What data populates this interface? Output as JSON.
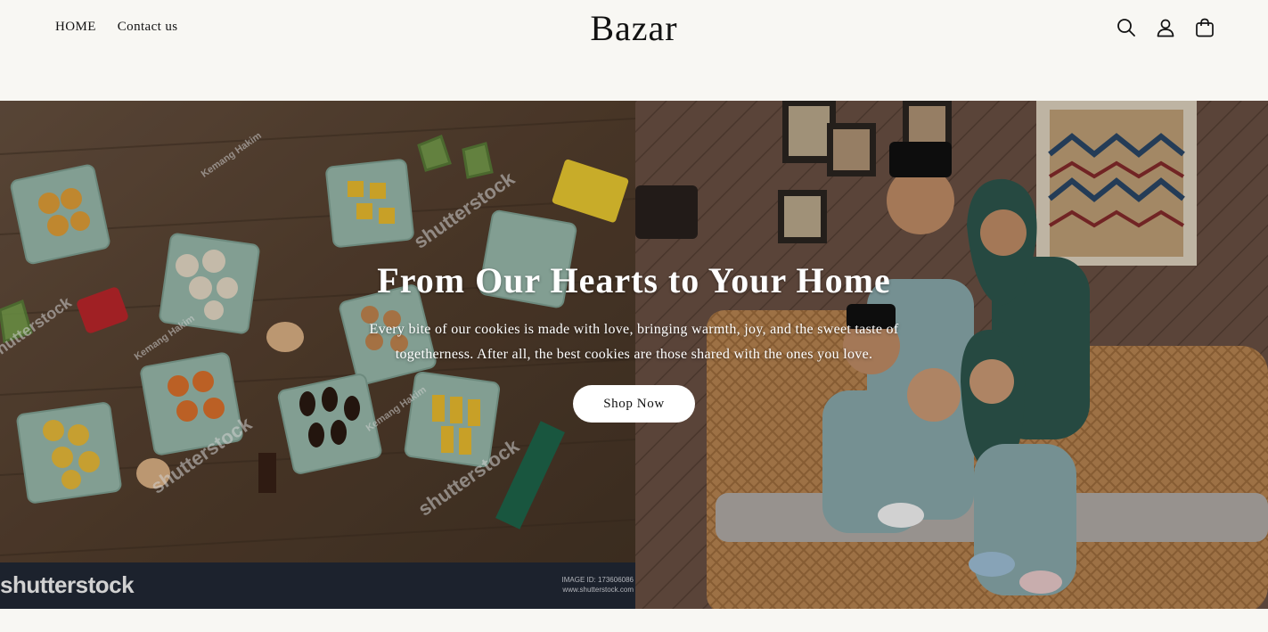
{
  "header": {
    "nav": [
      {
        "label": "HOME"
      },
      {
        "label": "Contact us"
      }
    ],
    "logo": "Bazar",
    "icons": [
      "search-icon",
      "account-icon",
      "cart-icon"
    ]
  },
  "hero": {
    "title": "From Our Hearts to Your Home",
    "text": "Every bite of our cookies is made with love, bringing warmth, joy, and the sweet taste of togetherness. After all, the best cookies are those shared with the ones you love.",
    "button_label": "Shop Now",
    "watermark": {
      "logo": "shutterstock",
      "image_id": "IMAGE ID: 173606086",
      "site": "www.shutterstock.com",
      "credit": "Kemang Hakim"
    }
  },
  "colors": {
    "background": "#f8f7f3",
    "text": "#121212",
    "button_bg": "#ffffff",
    "watermark_bar": "#232a38"
  }
}
